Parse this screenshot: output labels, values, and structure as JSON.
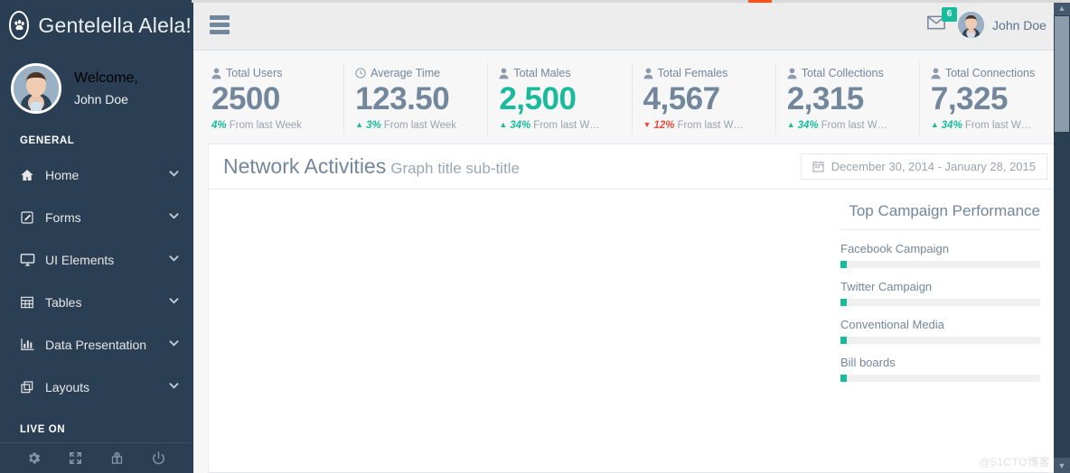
{
  "sidebar": {
    "brand": {
      "logo_icon": "paw-icon",
      "title": "Gentelella Alela!"
    },
    "profile": {
      "welcome": "Welcome,",
      "name": "John Doe",
      "avatar_icon": "user-avatar"
    },
    "section_general": "GENERAL",
    "section_live": "LIVE ON",
    "items": [
      {
        "label": "Home",
        "icon": "home-icon",
        "caret": "⌄"
      },
      {
        "label": "Forms",
        "icon": "edit-icon",
        "caret": "⌄"
      },
      {
        "label": "UI Elements",
        "icon": "desktop-icon",
        "caret": "⌄"
      },
      {
        "label": "Tables",
        "icon": "table-icon",
        "caret": "⌄"
      },
      {
        "label": "Data Presentation",
        "icon": "bar-chart-icon",
        "caret": "⌄"
      },
      {
        "label": "Layouts",
        "icon": "clone-icon",
        "caret": "⌄"
      }
    ],
    "footer_icons": [
      "gear-icon",
      "fullscreen-icon",
      "lock-icon",
      "power-icon"
    ]
  },
  "navbar": {
    "toggle_icon": "hamburger-icon",
    "mail_icon": "envelope-icon",
    "mail_badge": "6",
    "user_name": "John Doe",
    "user_caret": "▾"
  },
  "tiles": [
    {
      "icon": "user-icon",
      "title": "Total Users",
      "count": "2500",
      "count_color": "#73879C",
      "trend": "none",
      "pct": "4%",
      "pct_color": "#1ABB9C",
      "foot": "From last Week"
    },
    {
      "icon": "clock-icon",
      "title": "Average Time",
      "count": "123.50",
      "count_color": "#73879C",
      "trend": "up",
      "pct": "3%",
      "pct_color": "#1ABB9C",
      "foot": "From last Week"
    },
    {
      "icon": "user-icon",
      "title": "Total Males",
      "count": "2,500",
      "count_color": "#1ABB9C",
      "trend": "up",
      "pct": "34%",
      "pct_color": "#1ABB9C",
      "foot": "From last W…"
    },
    {
      "icon": "user-icon",
      "title": "Total Females",
      "count": "4,567",
      "count_color": "#73879C",
      "trend": "down",
      "pct": "12%",
      "pct_color": "#E74C3C",
      "foot": "From last W…"
    },
    {
      "icon": "user-icon",
      "title": "Total Collections",
      "count": "2,315",
      "count_color": "#73879C",
      "trend": "up",
      "pct": "34%",
      "pct_color": "#1ABB9C",
      "foot": "From last W…"
    },
    {
      "icon": "user-icon",
      "title": "Total Connections",
      "count": "7,325",
      "count_color": "#73879C",
      "trend": "up",
      "pct": "34%",
      "pct_color": "#1ABB9C",
      "foot": "From last W…"
    }
  ],
  "panel": {
    "title": "Network Activities",
    "subtitle": "Graph title sub-title",
    "daterange": {
      "icon": "calendar-icon",
      "value": "December 30, 2014 - January 28, 2015"
    }
  },
  "campaigns": {
    "title": "Top Campaign Performance",
    "items": [
      {
        "label": "Facebook Campaign",
        "percent": 3
      },
      {
        "label": "Twitter Campaign",
        "percent": 3
      },
      {
        "label": "Conventional Media",
        "percent": 3
      },
      {
        "label": "Bill boards",
        "percent": 3
      }
    ]
  },
  "chart_data": {
    "type": "line",
    "title": "Network Activities",
    "subtitle": "Graph title sub-title",
    "x": [],
    "series": [],
    "xlabel": "",
    "ylabel": "",
    "note": "chart canvas is blank / not yet rendered"
  },
  "scrollbar": {
    "up_arrow": "▲",
    "down_arrow": "▼"
  },
  "watermark": "@51CTO博客",
  "colors": {
    "sidebar": "#2A3F54",
    "accent_green": "#1ABB9C",
    "text_slate": "#73879C",
    "danger": "#E74C3C",
    "loading": "#FF4F16"
  }
}
